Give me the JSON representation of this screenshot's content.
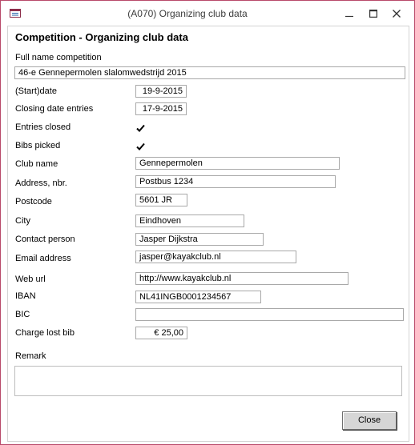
{
  "window": {
    "title": "(A070) Organizing club data",
    "icons": {
      "app": "form-icon",
      "minimize": "minimize-icon",
      "maximize": "maximize-icon",
      "close": "close-icon"
    }
  },
  "form": {
    "heading": "Competition - Organizing club data",
    "full_name_label": "Full name competition",
    "full_name_value": "46-e Gennepermolen slalomwedstrijd 2015",
    "start_date_label": "(Start)date",
    "start_date_value": "19-9-2015",
    "closing_date_label": "Closing date entries",
    "closing_date_value": "17-9-2015",
    "entries_closed_label": "Entries closed",
    "entries_closed_checked": true,
    "bibs_picked_label": "Bibs picked",
    "bibs_picked_checked": true,
    "club_name_label": "Club name",
    "club_name_value": "Gennepermolen",
    "address_label": "Address, nbr.",
    "address_value": "Postbus 1234",
    "postcode_label": "Postcode",
    "postcode_value": "5601 JR",
    "city_label": "City",
    "city_value": "Eindhoven",
    "contact_label": "Contact person",
    "contact_value": "Jasper Dijkstra",
    "email_label": "Email address",
    "email_value": "jasper@kayakclub.nl",
    "web_label": "Web url",
    "web_value": "http://www.kayakclub.nl",
    "iban_label": "IBAN",
    "iban_value": "NL41INGB0001234567",
    "bic_label": "BIC",
    "bic_value": "",
    "charge_label": "Charge lost bib",
    "charge_value": "€ 25,00",
    "remark_label": "Remark",
    "remark_value": "",
    "close_label": "Close"
  }
}
